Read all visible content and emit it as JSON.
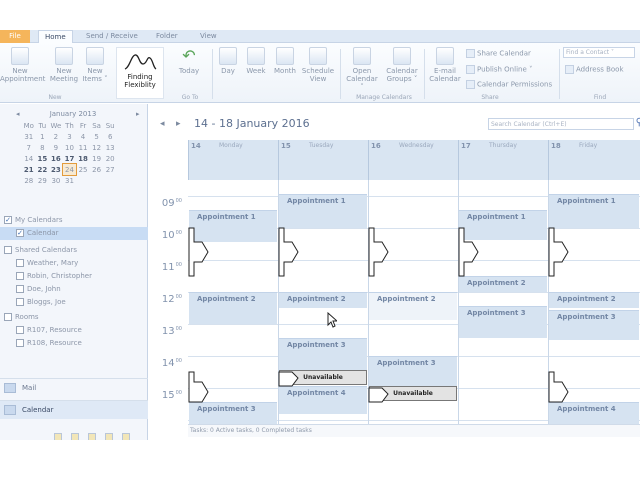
{
  "ribbon": {
    "tabs": [
      {
        "label": "File"
      },
      {
        "label": "Home"
      },
      {
        "label": "Send / Receive"
      },
      {
        "label": "Folder"
      },
      {
        "label": "View"
      }
    ],
    "new_appointment": "New Appointment",
    "new_meeting": "New Meeting",
    "new_items": "New Items ˅",
    "finding_flexibility": "Finding Flexiblity",
    "today": "Today",
    "day": "Day",
    "week": "Week",
    "month": "Month",
    "schedule_view": "Schedule View",
    "open_calendar": "Open Calendar ˅",
    "calendar_groups": "Calendar Groups ˅",
    "email_calendar": "E-mail Calendar",
    "share_calendar": "Share Calendar",
    "publish_online": "Publish Online ˅",
    "calendar_permissions": "Calendar Permissions",
    "find_contact_placeholder": "Find a Contact ˅",
    "address_book": "Address Book",
    "groups": {
      "new": "New",
      "goto": "Go To",
      "manage": "Manage Calendars",
      "share": "Share",
      "find": "Find"
    }
  },
  "minical": {
    "title": "January 2013",
    "prev": "◂",
    "next": "▸",
    "weekdays": [
      "Mo",
      "Tu",
      "We",
      "Th",
      "Fr",
      "Sa",
      "Su"
    ],
    "weeks": [
      [
        "31",
        "1",
        "2",
        "3",
        "4",
        "5",
        "6"
      ],
      [
        "7",
        "8",
        "9",
        "10",
        "11",
        "12",
        "13"
      ],
      [
        "14",
        "15",
        "16",
        "17",
        "18",
        "19",
        "20"
      ],
      [
        "21",
        "22",
        "23",
        "24",
        "25",
        "26",
        "27"
      ],
      [
        "28",
        "29",
        "30",
        "31",
        "",
        "",
        ""
      ]
    ]
  },
  "folders": {
    "my_calendars": "My Calendars",
    "calendar": "Calendar",
    "shared_calendars": "Shared Calendars",
    "shared": [
      "Weather, Mary",
      "Robin, Christopher",
      "Doe, John",
      "Bloggs, Joe"
    ],
    "rooms": "Rooms",
    "room_list": [
      "R107, Resource",
      "R108, Resource"
    ]
  },
  "nav": {
    "mail": "Mail",
    "calendar": "Calendar"
  },
  "calendar": {
    "prev_arrow": "◂",
    "next_arrow": "▸",
    "range_title": "14 - 18 January 2016",
    "search_placeholder": "Search Calendar (Ctrl+E)",
    "days": [
      {
        "num": "14",
        "name": "Monday"
      },
      {
        "num": "15",
        "name": "Tuesday"
      },
      {
        "num": "16",
        "name": "Wednesday"
      },
      {
        "num": "17",
        "name": "Thursday"
      },
      {
        "num": "18",
        "name": "Friday"
      }
    ],
    "hours": [
      "09",
      "10",
      "11",
      "12",
      "13",
      "14",
      "15"
    ],
    "hour_suffix": "00",
    "appt1": "Appointment 1",
    "appt2": "Appointment 2",
    "appt3": "Appointment 3",
    "appt4": "Appointment 4",
    "unavailable": "Unavailable",
    "tasks_status": "Tasks: 0 Active tasks, 0 Completed tasks"
  }
}
